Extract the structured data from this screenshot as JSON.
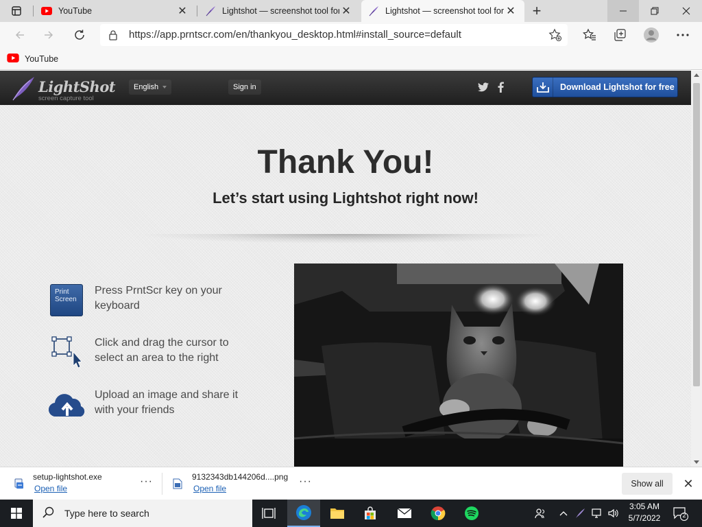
{
  "browser": {
    "tabs": [
      {
        "title": "YouTube",
        "favicon": "youtube-icon",
        "active": false
      },
      {
        "title": "Lightshot — screenshot tool for",
        "favicon": "lightshot-feather-icon",
        "active": false
      },
      {
        "title": "Lightshot — screenshot tool for",
        "favicon": "lightshot-feather-icon",
        "active": true
      }
    ],
    "url": "https://app.prntscr.com/en/thankyou_desktop.html#install_source=default",
    "bookmarks": [
      {
        "label": "YouTube",
        "icon": "youtube-icon"
      }
    ]
  },
  "site": {
    "logo_name": "LightShot",
    "logo_tagline": "screen capture tool",
    "language": "English",
    "sign_in": "Sign in",
    "download_button": "Download Lightshot for free",
    "social": [
      "twitter-icon",
      "facebook-icon"
    ]
  },
  "content": {
    "headline": "Thank You!",
    "subheadline": "Let’s start using Lightshot right now!",
    "key_label_line1": "Print",
    "key_label_line2": "Screen",
    "steps": [
      {
        "icon": "print-screen-key-icon",
        "text": "Press PrntScr key on your keyboard"
      },
      {
        "icon": "selection-cursor-icon",
        "text": "Click and drag the cursor to select an area to the right"
      },
      {
        "icon": "cloud-upload-icon",
        "text": "Upload an image and share it with your friends"
      }
    ],
    "image": "black-and-white photo of a cat"
  },
  "downloads": {
    "items": [
      {
        "file": "setup-lightshot.exe",
        "action": "Open file"
      },
      {
        "file": "9132343db144206d....png",
        "action": "Open file"
      }
    ],
    "show_all": "Show all"
  },
  "taskbar": {
    "search_placeholder": "Type here to search",
    "time": "3:05 AM",
    "date": "5/7/2022",
    "notification_count": "2"
  },
  "colors": {
    "header_dark": "#2a2a2a",
    "download_blue": "#2a5fae",
    "link_blue": "#1a5fb4",
    "youtube_red": "#ff0000",
    "lightshot_purple": "#8d6cc9"
  }
}
